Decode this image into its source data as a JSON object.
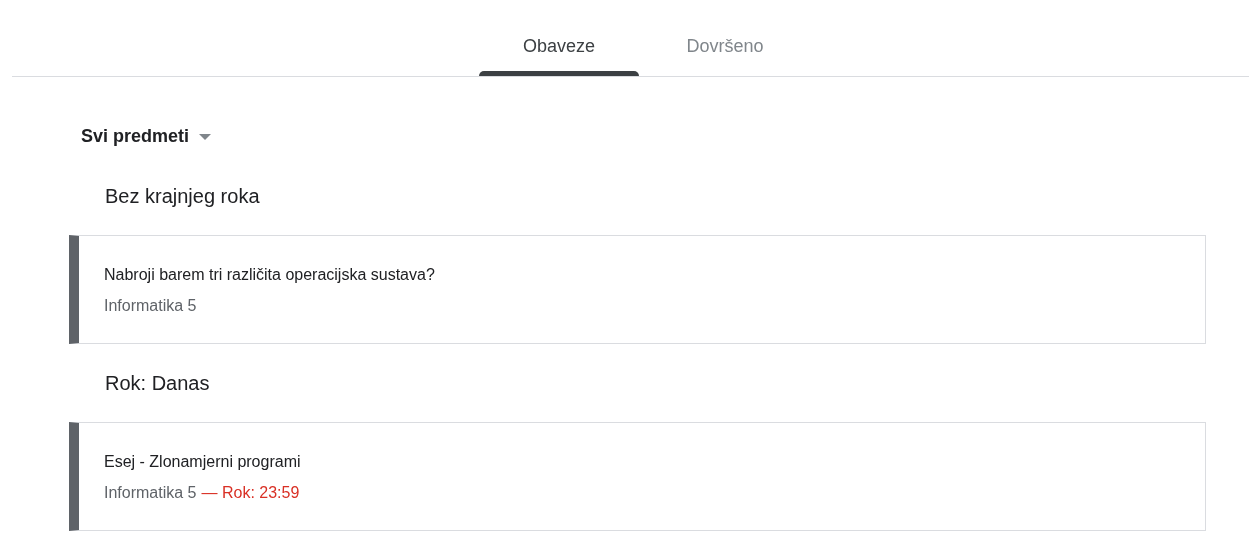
{
  "tabs": [
    {
      "label": "Obaveze",
      "selected": true
    },
    {
      "label": "Dovršeno",
      "selected": false
    }
  ],
  "filter": {
    "label": "Svi predmeti"
  },
  "sections": [
    {
      "heading": "Bez krajnjeg roka",
      "items": [
        {
          "title": "Nabroji barem tri različita operacijska sustava?",
          "course": "Informatika 5"
        }
      ]
    },
    {
      "heading": "Rok: Danas",
      "items": [
        {
          "title": "Esej - Zlonamjerni programi",
          "course": "Informatika 5",
          "due": "— Rok: 23:59"
        }
      ]
    }
  ]
}
